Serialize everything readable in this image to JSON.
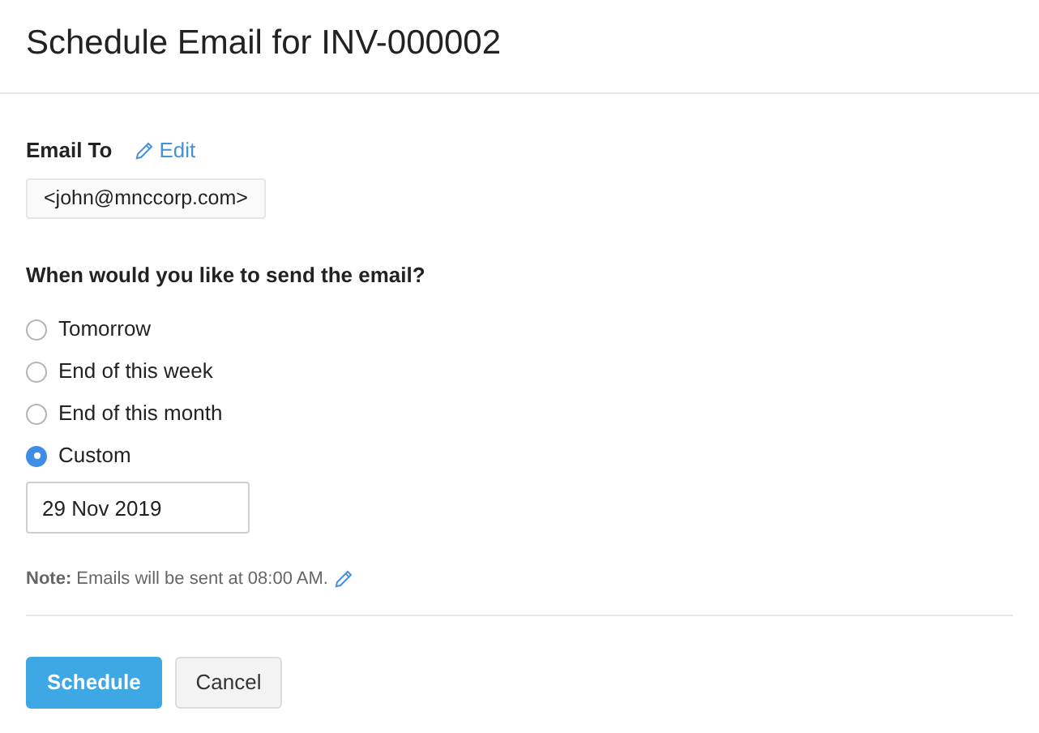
{
  "title": "Schedule Email for INV-000002",
  "email_to": {
    "label": "Email To",
    "edit": "Edit",
    "recipient": "<john@mnccorp.com>"
  },
  "question": "When would you like to send the email?",
  "options": [
    {
      "label": "Tomorrow",
      "selected": false
    },
    {
      "label": "End of this week",
      "selected": false
    },
    {
      "label": "End of this month",
      "selected": false
    },
    {
      "label": "Custom",
      "selected": true
    }
  ],
  "date": {
    "value": "29 Nov 2019"
  },
  "note": "**Note:** Emails will be sent at 08:00 AM.",
  "buttons": [
    {
      "label": "Schedule",
      "kind": "primary"
    },
    {
      "label": "Cancel",
      "kind": "secondary"
    }
  ]
}
